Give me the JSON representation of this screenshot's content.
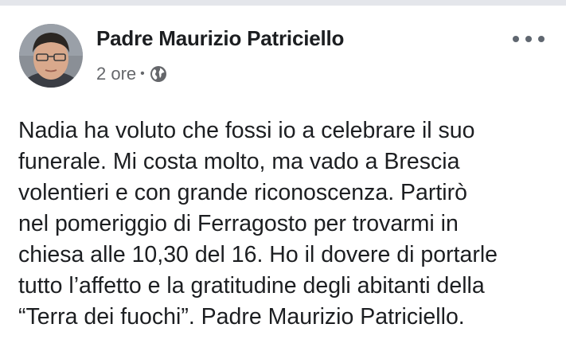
{
  "post": {
    "author_name": "Padre Maurizio Patriciello",
    "timestamp": "2 ore",
    "separator": "•",
    "audience_icon": "globe-icon",
    "more_icon": "more-options-icon",
    "text_lines": [
      "Nadia ha voluto che fossi io a celebrare il suo",
      "funerale. Mi costa molto, ma vado a Brescia",
      "volentieri e con grande riconoscenza. Partirò",
      "nel pomeriggio di Ferragosto per trovarmi in",
      "chiesa alle 10,30 del 16. Ho il dovere di portarle",
      "tutto l’affetto e la gratitudine degli abitanti della",
      "“Terra dei fuochi”. Padre Maurizio Patriciello."
    ]
  },
  "colors": {
    "text_primary": "#1c1e21",
    "text_secondary": "#65676b",
    "icon_gray": "#606770",
    "top_strip": "#e4e6eb"
  }
}
